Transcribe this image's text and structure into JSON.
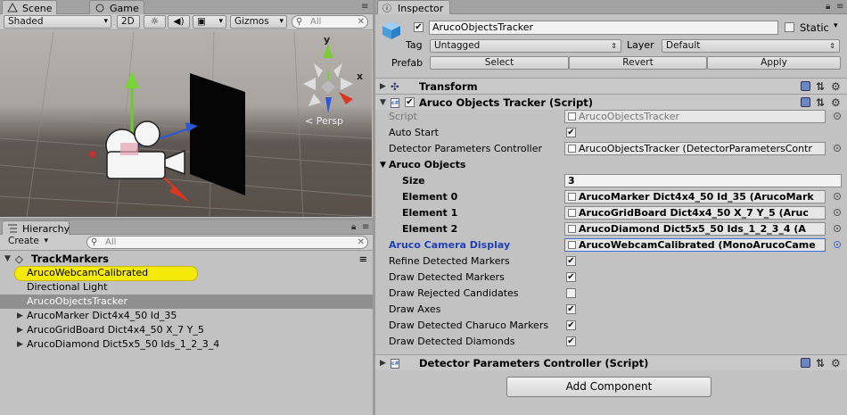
{
  "scene_tabs": {
    "scene": "Scene",
    "game": "Game"
  },
  "scene_toolbar": {
    "shading": "Shaded",
    "mode_2d": "2D",
    "gizmos": "Gizmos",
    "search_placeholder": "All"
  },
  "scene_view": {
    "axis_y": "y",
    "axis_x": "x",
    "persp": "Persp"
  },
  "hierarchy": {
    "tab": "Hierarchy",
    "create": "Create",
    "search_placeholder": "All",
    "scene_name": "TrackMarkers",
    "items": [
      {
        "label": "ArucoWebcamCalibrated",
        "highlighted": true
      },
      {
        "label": "Directional Light"
      },
      {
        "label": "ArucoObjectsTracker",
        "selected": true
      },
      {
        "label": "ArucoMarker Dict4x4_50 Id_35",
        "expandable": true
      },
      {
        "label": "ArucoGridBoard Dict4x4_50 X_7 Y_5",
        "expandable": true
      },
      {
        "label": "ArucoDiamond Dict5x5_50 Ids_1_2_3_4",
        "expandable": true
      }
    ]
  },
  "inspector": {
    "tab": "Inspector",
    "object_name": "ArucoObjectsTracker",
    "static_label": "Static",
    "tag_label": "Tag",
    "tag_value": "Untagged",
    "layer_label": "Layer",
    "layer_value": "Default",
    "prefab_label": "Prefab",
    "prefab_select": "Select",
    "prefab_revert": "Revert",
    "prefab_apply": "Apply",
    "transform_title": "Transform",
    "component_title": "Aruco Objects Tracker (Script)",
    "script_label": "Script",
    "script_value": "ArucoObjectsTracker",
    "auto_start_label": "Auto Start",
    "detector_params_label": "Detector Parameters Controller",
    "detector_params_value": "ArucoObjectsTracker (DetectorParametersContr",
    "aruco_objects_label": "Aruco Objects",
    "size_label": "Size",
    "size_value": "3",
    "element0_label": "Element 0",
    "element0_value": "ArucoMarker Dict4x4_50 Id_35 (ArucoMark",
    "element1_label": "Element 1",
    "element1_value": "ArucoGridBoard Dict4x4_50 X_7 Y_5 (Aruc",
    "element2_label": "Element 2",
    "element2_value": "ArucoDiamond Dict5x5_50 Ids_1_2_3_4 (A",
    "camera_display_label": "Aruco Camera Display",
    "camera_display_value": "ArucoWebcamCalibrated (MonoArucoCame",
    "options": [
      {
        "label": "Refine Detected Markers",
        "checked": true
      },
      {
        "label": "Draw Detected Markers",
        "checked": true
      },
      {
        "label": "Draw Rejected Candidates",
        "checked": false
      },
      {
        "label": "Draw Axes",
        "checked": true
      },
      {
        "label": "Draw Detected Charuco Markers",
        "checked": true
      },
      {
        "label": "Draw Detected Diamonds",
        "checked": true
      }
    ],
    "detector_section_title": "Detector Parameters Controller (Script)",
    "add_component": "Add Component"
  },
  "colors": {
    "panel_bg": "#c2c2c2",
    "selection": "#8f8f8f",
    "highlight_yellow": "#f5e90a",
    "link_blue": "#1f3fb8"
  }
}
